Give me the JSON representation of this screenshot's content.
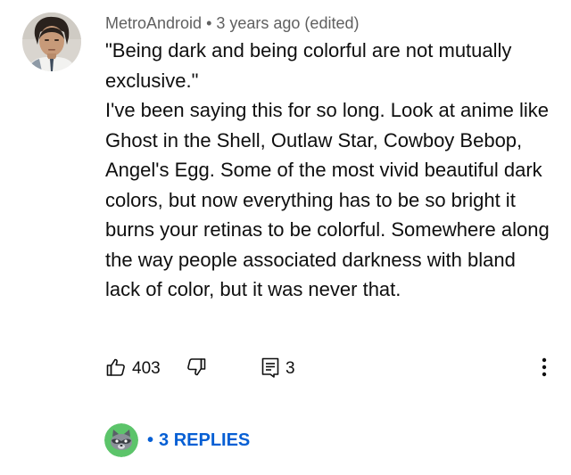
{
  "comment": {
    "author": "MetroAndroid",
    "separator": "•",
    "timestamp": "3 years ago (edited)",
    "paragraphs": [
      "\"Being dark and being colorful are not mutually exclusive.\"",
      "I've been saying this for so long. Look at anime like Ghost in the Shell, Outlaw Star, Cowboy Bebop, Angel's Egg. Some of the most vivid beautiful dark colors, but now everything has to be so bright it burns your retinas to be colorful. Somewhere along the way people associated darkness with bland lack of color, but it was never that."
    ],
    "actions": {
      "like_icon": "thumbs-up-icon",
      "like_count": "403",
      "dislike_icon": "thumbs-down-icon",
      "reply_icon": "reply-comment-icon",
      "reply_count": "3",
      "more_icon": "vertical-dots-icon"
    },
    "replies": {
      "avatar_icon": "raccoon-avatar",
      "separator": "•",
      "label": "3 REPLIES"
    }
  },
  "colors": {
    "link": "#065fd4",
    "meta_text": "#606060",
    "body_text": "#0f0f0f",
    "reply_avatar_bg": "#5cc46a"
  }
}
